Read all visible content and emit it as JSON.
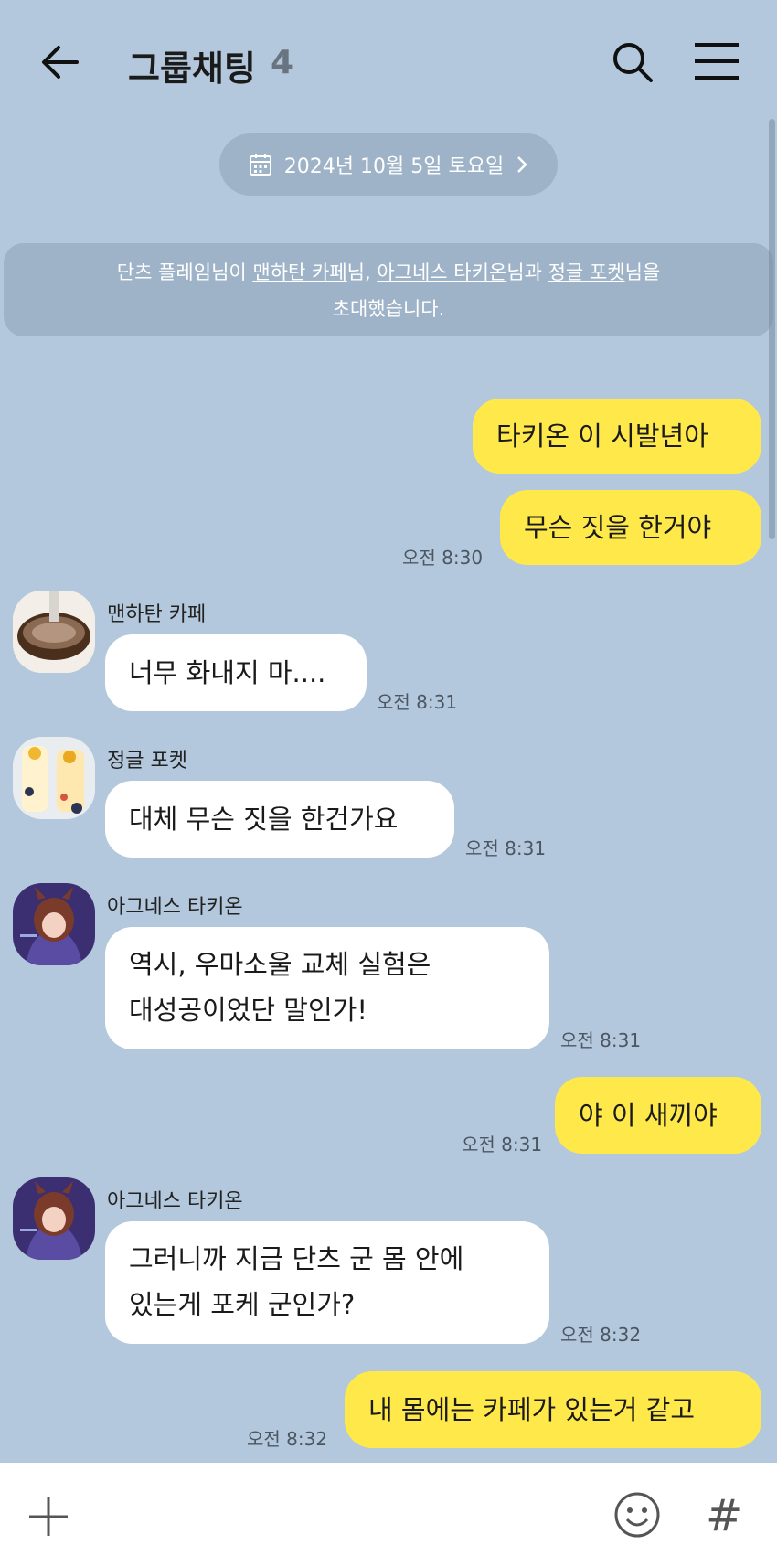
{
  "header": {
    "title": "그룹채팅",
    "count": "4",
    "icons": [
      "back-arrow-icon",
      "search-icon",
      "menu-icon"
    ]
  },
  "date_pill": {
    "label": "2024년 10월 5일 토요일"
  },
  "system": {
    "pre": "단츠 플레임님이 ",
    "name1": "맨하탄 카페",
    "mid1": "님, ",
    "name2": "아그네스 타키온",
    "mid2": "님과 ",
    "name3": "정글 포켓",
    "post": "님을",
    "line2": "초대했습니다."
  },
  "messages": [
    {
      "text": "타키온 이 시발년아"
    },
    {
      "text": "무슨 짓을 한거야",
      "time": "오전 8:30"
    },
    {
      "sender": "맨하탄 카페",
      "text": "너무 화내지 마....",
      "time": "오전 8:31"
    },
    {
      "sender": "정글 포켓",
      "text": "대체 무슨 짓을 한건가요",
      "time": "오전 8:31"
    },
    {
      "sender": "아그네스 타키온",
      "line1": "역시, 우마소울 교체 실험은",
      "line2": "대성공이었단 말인가!",
      "time": "오전 8:31"
    },
    {
      "text": "야 이 새끼야",
      "time": "오전 8:31"
    },
    {
      "sender": "아그네스 타키온",
      "line1": "그러니까 지금 단츠 군 몸 안에",
      "line2": "있는게 포케 군인가?",
      "time": "오전 8:32"
    },
    {
      "text": "내 몸에는 카페가 있는거 같고",
      "time": "오전 8:32"
    }
  ],
  "bottom": {
    "hash": "#"
  },
  "colors": {
    "background": "#b3c8dc",
    "my_bubble": "#ffe94a",
    "other_bubble": "#ffffff"
  }
}
